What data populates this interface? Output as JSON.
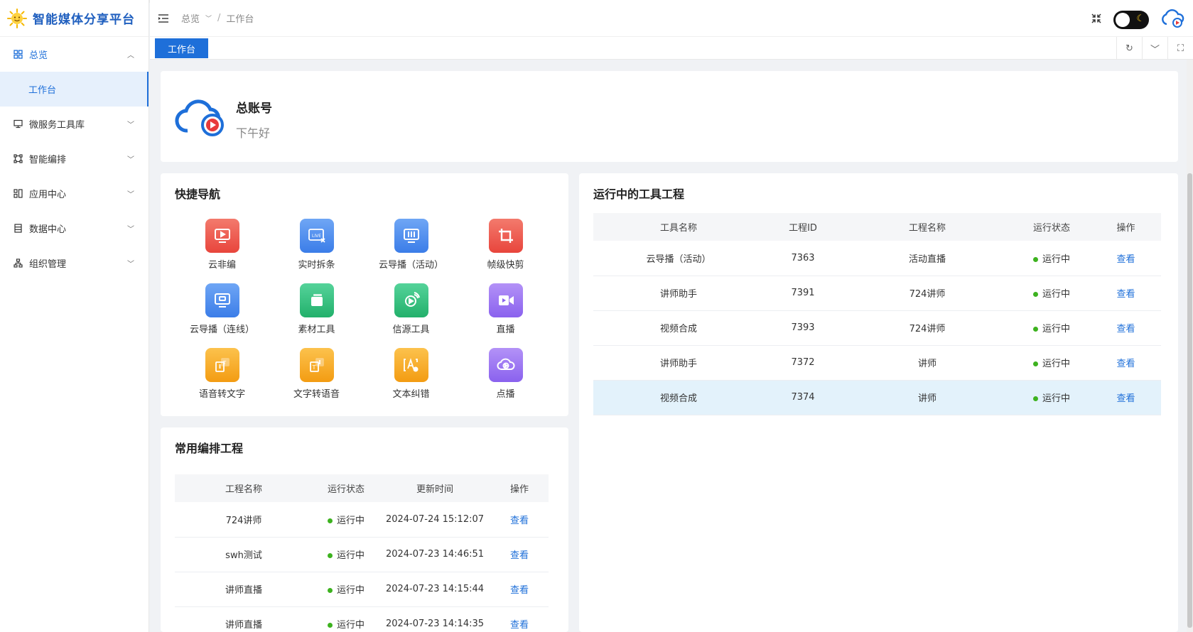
{
  "app": {
    "title": "智能媒体分享平台"
  },
  "sidebar": {
    "items": [
      {
        "label": "总览",
        "icon": "grid-icon",
        "expanded": true
      },
      {
        "label": "微服务工具库",
        "icon": "monitor-icon"
      },
      {
        "label": "智能编排",
        "icon": "flow-icon"
      },
      {
        "label": "应用中心",
        "icon": "apps-icon"
      },
      {
        "label": "数据中心",
        "icon": "database-icon"
      },
      {
        "label": "组织管理",
        "icon": "org-icon"
      }
    ],
    "submenu": {
      "label": "工作台"
    }
  },
  "header": {
    "breadcrumb": [
      "总览",
      "工作台"
    ],
    "breadcrumb_sep": "/"
  },
  "tabs": {
    "active": "工作台"
  },
  "welcome": {
    "title": "总账号",
    "greeting": "下午好"
  },
  "quick_nav": {
    "title": "快捷导航",
    "items": [
      {
        "label": "云非编",
        "color": "#f0504d"
      },
      {
        "label": "实时拆条",
        "color": "#4a8df0"
      },
      {
        "label": "云导播（活动）",
        "color": "#4a8df0"
      },
      {
        "label": "帧级快剪",
        "color": "#f0504d"
      },
      {
        "label": "云导播（连线）",
        "color": "#4a8df0"
      },
      {
        "label": "素材工具",
        "color": "#2fbf7a"
      },
      {
        "label": "信源工具",
        "color": "#2fbf7a"
      },
      {
        "label": "直播",
        "color": "#9b6ff0"
      },
      {
        "label": "语音转文字",
        "color": "#f5a623"
      },
      {
        "label": "文字转语音",
        "color": "#f5a623"
      },
      {
        "label": "文本纠错",
        "color": "#f5a623"
      },
      {
        "label": "点播",
        "color": "#9b6ff0"
      }
    ]
  },
  "common_projects": {
    "title": "常用编排工程",
    "columns": [
      "工程名称",
      "运行状态",
      "更新时间",
      "操作"
    ],
    "rows": [
      {
        "name": "724讲师",
        "status": "运行中",
        "time": "2024-07-24 15:12:07",
        "action": "查看"
      },
      {
        "name": "swh测试",
        "status": "运行中",
        "time": "2024-07-23 14:46:51",
        "action": "查看"
      },
      {
        "name": "讲师直播",
        "status": "运行中",
        "time": "2024-07-23 14:15:44",
        "action": "查看"
      },
      {
        "name": "讲师直播",
        "status": "运行中",
        "time": "2024-07-23 14:14:35",
        "action": "查看"
      }
    ]
  },
  "running_tools": {
    "title": "运行中的工具工程",
    "columns": [
      "工具名称",
      "工程ID",
      "工程名称",
      "运行状态",
      "操作"
    ],
    "rows": [
      {
        "tool": "云导播（活动）",
        "id": "7363",
        "project": "活动直播",
        "status": "运行中",
        "action": "查看"
      },
      {
        "tool": "讲师助手",
        "id": "7391",
        "project": "724讲师",
        "status": "运行中",
        "action": "查看"
      },
      {
        "tool": "视频合成",
        "id": "7393",
        "project": "724讲师",
        "status": "运行中",
        "action": "查看"
      },
      {
        "tool": "讲师助手",
        "id": "7372",
        "project": "讲师",
        "status": "运行中",
        "action": "查看"
      },
      {
        "tool": "视频合成",
        "id": "7374",
        "project": "讲师",
        "status": "运行中",
        "action": "查看"
      }
    ]
  }
}
